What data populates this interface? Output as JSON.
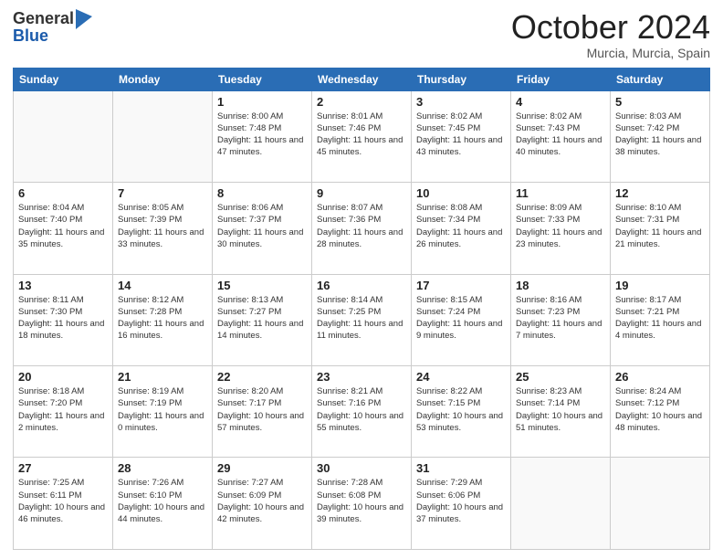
{
  "header": {
    "logo_general": "General",
    "logo_blue": "Blue",
    "month_title": "October 2024",
    "subtitle": "Murcia, Murcia, Spain"
  },
  "days_of_week": [
    "Sunday",
    "Monday",
    "Tuesday",
    "Wednesday",
    "Thursday",
    "Friday",
    "Saturday"
  ],
  "weeks": [
    [
      {
        "day": "",
        "info": ""
      },
      {
        "day": "",
        "info": ""
      },
      {
        "day": "1",
        "info": "Sunrise: 8:00 AM\nSunset: 7:48 PM\nDaylight: 11 hours and 47 minutes."
      },
      {
        "day": "2",
        "info": "Sunrise: 8:01 AM\nSunset: 7:46 PM\nDaylight: 11 hours and 45 minutes."
      },
      {
        "day": "3",
        "info": "Sunrise: 8:02 AM\nSunset: 7:45 PM\nDaylight: 11 hours and 43 minutes."
      },
      {
        "day": "4",
        "info": "Sunrise: 8:02 AM\nSunset: 7:43 PM\nDaylight: 11 hours and 40 minutes."
      },
      {
        "day": "5",
        "info": "Sunrise: 8:03 AM\nSunset: 7:42 PM\nDaylight: 11 hours and 38 minutes."
      }
    ],
    [
      {
        "day": "6",
        "info": "Sunrise: 8:04 AM\nSunset: 7:40 PM\nDaylight: 11 hours and 35 minutes."
      },
      {
        "day": "7",
        "info": "Sunrise: 8:05 AM\nSunset: 7:39 PM\nDaylight: 11 hours and 33 minutes."
      },
      {
        "day": "8",
        "info": "Sunrise: 8:06 AM\nSunset: 7:37 PM\nDaylight: 11 hours and 30 minutes."
      },
      {
        "day": "9",
        "info": "Sunrise: 8:07 AM\nSunset: 7:36 PM\nDaylight: 11 hours and 28 minutes."
      },
      {
        "day": "10",
        "info": "Sunrise: 8:08 AM\nSunset: 7:34 PM\nDaylight: 11 hours and 26 minutes."
      },
      {
        "day": "11",
        "info": "Sunrise: 8:09 AM\nSunset: 7:33 PM\nDaylight: 11 hours and 23 minutes."
      },
      {
        "day": "12",
        "info": "Sunrise: 8:10 AM\nSunset: 7:31 PM\nDaylight: 11 hours and 21 minutes."
      }
    ],
    [
      {
        "day": "13",
        "info": "Sunrise: 8:11 AM\nSunset: 7:30 PM\nDaylight: 11 hours and 18 minutes."
      },
      {
        "day": "14",
        "info": "Sunrise: 8:12 AM\nSunset: 7:28 PM\nDaylight: 11 hours and 16 minutes."
      },
      {
        "day": "15",
        "info": "Sunrise: 8:13 AM\nSunset: 7:27 PM\nDaylight: 11 hours and 14 minutes."
      },
      {
        "day": "16",
        "info": "Sunrise: 8:14 AM\nSunset: 7:25 PM\nDaylight: 11 hours and 11 minutes."
      },
      {
        "day": "17",
        "info": "Sunrise: 8:15 AM\nSunset: 7:24 PM\nDaylight: 11 hours and 9 minutes."
      },
      {
        "day": "18",
        "info": "Sunrise: 8:16 AM\nSunset: 7:23 PM\nDaylight: 11 hours and 7 minutes."
      },
      {
        "day": "19",
        "info": "Sunrise: 8:17 AM\nSunset: 7:21 PM\nDaylight: 11 hours and 4 minutes."
      }
    ],
    [
      {
        "day": "20",
        "info": "Sunrise: 8:18 AM\nSunset: 7:20 PM\nDaylight: 11 hours and 2 minutes."
      },
      {
        "day": "21",
        "info": "Sunrise: 8:19 AM\nSunset: 7:19 PM\nDaylight: 11 hours and 0 minutes."
      },
      {
        "day": "22",
        "info": "Sunrise: 8:20 AM\nSunset: 7:17 PM\nDaylight: 10 hours and 57 minutes."
      },
      {
        "day": "23",
        "info": "Sunrise: 8:21 AM\nSunset: 7:16 PM\nDaylight: 10 hours and 55 minutes."
      },
      {
        "day": "24",
        "info": "Sunrise: 8:22 AM\nSunset: 7:15 PM\nDaylight: 10 hours and 53 minutes."
      },
      {
        "day": "25",
        "info": "Sunrise: 8:23 AM\nSunset: 7:14 PM\nDaylight: 10 hours and 51 minutes."
      },
      {
        "day": "26",
        "info": "Sunrise: 8:24 AM\nSunset: 7:12 PM\nDaylight: 10 hours and 48 minutes."
      }
    ],
    [
      {
        "day": "27",
        "info": "Sunrise: 7:25 AM\nSunset: 6:11 PM\nDaylight: 10 hours and 46 minutes."
      },
      {
        "day": "28",
        "info": "Sunrise: 7:26 AM\nSunset: 6:10 PM\nDaylight: 10 hours and 44 minutes."
      },
      {
        "day": "29",
        "info": "Sunrise: 7:27 AM\nSunset: 6:09 PM\nDaylight: 10 hours and 42 minutes."
      },
      {
        "day": "30",
        "info": "Sunrise: 7:28 AM\nSunset: 6:08 PM\nDaylight: 10 hours and 39 minutes."
      },
      {
        "day": "31",
        "info": "Sunrise: 7:29 AM\nSunset: 6:06 PM\nDaylight: 10 hours and 37 minutes."
      },
      {
        "day": "",
        "info": ""
      },
      {
        "day": "",
        "info": ""
      }
    ]
  ]
}
